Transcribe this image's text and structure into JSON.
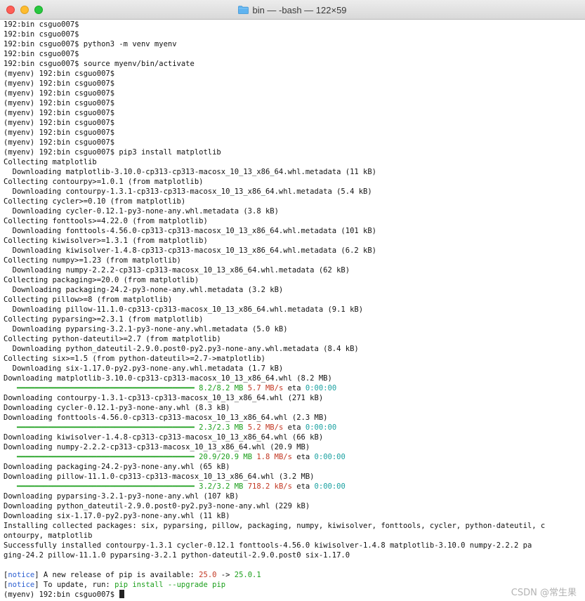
{
  "window": {
    "title": "bin — -bash — 122×59"
  },
  "lines": [
    "192:bin csguo007$",
    "192:bin csguo007$",
    "192:bin csguo007$ python3 -m venv myenv",
    "192:bin csguo007$",
    "192:bin csguo007$ source myenv/bin/activate",
    "(myenv) 192:bin csguo007$",
    "(myenv) 192:bin csguo007$",
    "(myenv) 192:bin csguo007$",
    "(myenv) 192:bin csguo007$",
    "(myenv) 192:bin csguo007$",
    "(myenv) 192:bin csguo007$",
    "(myenv) 192:bin csguo007$",
    "(myenv) 192:bin csguo007$",
    "(myenv) 192:bin csguo007$ pip3 install matplotlib",
    "Collecting matplotlib",
    "  Downloading matplotlib-3.10.0-cp313-cp313-macosx_10_13_x86_64.whl.metadata (11 kB)",
    "Collecting contourpy>=1.0.1 (from matplotlib)",
    "  Downloading contourpy-1.3.1-cp313-cp313-macosx_10_13_x86_64.whl.metadata (5.4 kB)",
    "Collecting cycler>=0.10 (from matplotlib)",
    "  Downloading cycler-0.12.1-py3-none-any.whl.metadata (3.8 kB)",
    "Collecting fonttools>=4.22.0 (from matplotlib)",
    "  Downloading fonttools-4.56.0-cp313-cp313-macosx_10_13_x86_64.whl.metadata (101 kB)",
    "Collecting kiwisolver>=1.3.1 (from matplotlib)",
    "  Downloading kiwisolver-1.4.8-cp313-cp313-macosx_10_13_x86_64.whl.metadata (6.2 kB)",
    "Collecting numpy>=1.23 (from matplotlib)",
    "  Downloading numpy-2.2.2-cp313-cp313-macosx_10_13_x86_64.whl.metadata (62 kB)",
    "Collecting packaging>=20.0 (from matplotlib)",
    "  Downloading packaging-24.2-py3-none-any.whl.metadata (3.2 kB)",
    "Collecting pillow>=8 (from matplotlib)",
    "  Downloading pillow-11.1.0-cp313-cp313-macosx_10_13_x86_64.whl.metadata (9.1 kB)",
    "Collecting pyparsing>=2.3.1 (from matplotlib)",
    "  Downloading pyparsing-3.2.1-py3-none-any.whl.metadata (5.0 kB)",
    "Collecting python-dateutil>=2.7 (from matplotlib)",
    "  Downloading python_dateutil-2.9.0.post0-py2.py3-none-any.whl.metadata (8.4 kB)",
    "Collecting six>=1.5 (from python-dateutil>=2.7->matplotlib)",
    "  Downloading six-1.17.0-py2.py3-none-any.whl.metadata (1.7 kB)",
    "Downloading matplotlib-3.10.0-cp313-cp313-macosx_10_13_x86_64.whl (8.2 MB)",
    {
      "progress": true,
      "size": "8.2/8.2 MB",
      "speed": "5.7 MB/s",
      "eta_label": "eta",
      "eta": "0:00:00"
    },
    "Downloading contourpy-1.3.1-cp313-cp313-macosx_10_13_x86_64.whl (271 kB)",
    "Downloading cycler-0.12.1-py3-none-any.whl (8.3 kB)",
    "Downloading fonttools-4.56.0-cp313-cp313-macosx_10_13_x86_64.whl (2.3 MB)",
    {
      "progress": true,
      "size": "2.3/2.3 MB",
      "speed": "5.2 MB/s",
      "eta_label": "eta",
      "eta": "0:00:00"
    },
    "Downloading kiwisolver-1.4.8-cp313-cp313-macosx_10_13_x86_64.whl (66 kB)",
    "Downloading numpy-2.2.2-cp313-cp313-macosx_10_13_x86_64.whl (20.9 MB)",
    {
      "progress": true,
      "size": "20.9/20.9 MB",
      "speed": "1.8 MB/s",
      "eta_label": "eta",
      "eta": "0:00:00"
    },
    "Downloading packaging-24.2-py3-none-any.whl (65 kB)",
    "Downloading pillow-11.1.0-cp313-cp313-macosx_10_13_x86_64.whl (3.2 MB)",
    {
      "progress": true,
      "size": "3.2/3.2 MB",
      "speed": "718.2 kB/s",
      "eta_label": "eta",
      "eta": "0:00:00"
    },
    "Downloading pyparsing-3.2.1-py3-none-any.whl (107 kB)",
    "Downloading python_dateutil-2.9.0.post0-py2.py3-none-any.whl (229 kB)",
    "Downloading six-1.17.0-py2.py3-none-any.whl (11 kB)",
    "Installing collected packages: six, pyparsing, pillow, packaging, numpy, kiwisolver, fonttools, cycler, python-dateutil, c",
    "ontourpy, matplotlib",
    "Successfully installed contourpy-1.3.1 cycler-0.12.1 fonttools-4.56.0 kiwisolver-1.4.8 matplotlib-3.10.0 numpy-2.2.2 pa",
    "ging-24.2 pillow-11.1.0 pyparsing-3.2.1 python-dateutil-2.9.0.post0 six-1.17.0",
    "",
    {
      "notice": true,
      "tag": "[notice]",
      "segments": [
        {
          "text": " A new release of pip is available: ",
          "color": ""
        },
        {
          "text": "25.0",
          "color": "red"
        },
        {
          "text": " -> ",
          "color": ""
        },
        {
          "text": "25.0.1",
          "color": "green"
        }
      ]
    },
    {
      "notice": true,
      "tag": "[notice]",
      "segments": [
        {
          "text": " To update, run: ",
          "color": ""
        },
        {
          "text": "pip install --upgrade pip",
          "color": "green"
        }
      ]
    },
    {
      "prompt": true,
      "text": "(myenv) 192:bin csguo007$ "
    }
  ],
  "progress_bar": {
    "fraction": 1.0,
    "color": "#1a9e1a",
    "bar_chars": 40
  },
  "colors": {
    "red": "#c23621",
    "green": "#1a9e1a",
    "cyan": "#1aa1a1",
    "blue": "#2c5fd1"
  },
  "watermark": "CSDN @常生果"
}
